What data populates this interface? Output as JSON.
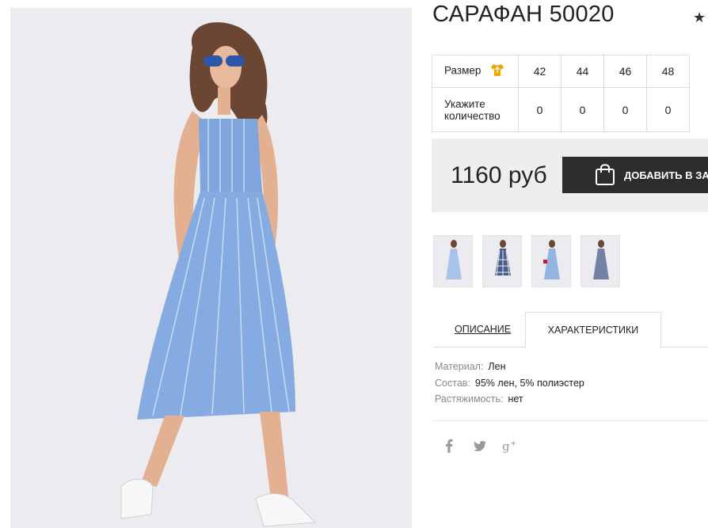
{
  "product": {
    "title": "САРАФАН 50020",
    "favorite_icon": "star-icon"
  },
  "sizes": {
    "size_label": "Размер",
    "size_guide_icon": "tshirt-icon",
    "qty_label_line1": "Укажите",
    "qty_label_line2": "количество",
    "items": [
      {
        "size": "42",
        "qty": "0"
      },
      {
        "size": "44",
        "qty": "0"
      },
      {
        "size": "46",
        "qty": "0"
      },
      {
        "size": "48",
        "qty": "0"
      }
    ]
  },
  "purchase": {
    "price": "1160 руб",
    "add_to_cart_label": "ДОБАВИТЬ В ЗАКАЗ",
    "cart_icon": "shopping-bag-icon"
  },
  "thumbnails": [
    "blue-striped-dress",
    "checkered-dress",
    "striped-dress-red-bag",
    "grey-striped-dress"
  ],
  "tabs": {
    "description": "ОПИСАНИЕ",
    "characteristics": "ХАРАКТЕРИСТИКИ",
    "active": "characteristics"
  },
  "specs": [
    {
      "key": "Материал:",
      "value": "Лен"
    },
    {
      "key": "Состав:",
      "value": "95% лен, 5% полиэстер"
    },
    {
      "key": "Растяжимость:",
      "value": "нет"
    }
  ],
  "social": [
    "facebook-icon",
    "twitter-icon",
    "google-plus-icon"
  ],
  "colors": {
    "button_bg": "#2d2d2d",
    "price_bar_bg": "#eeeeee",
    "size_icon": "#f0a800",
    "dress": "#7fa5dc"
  }
}
